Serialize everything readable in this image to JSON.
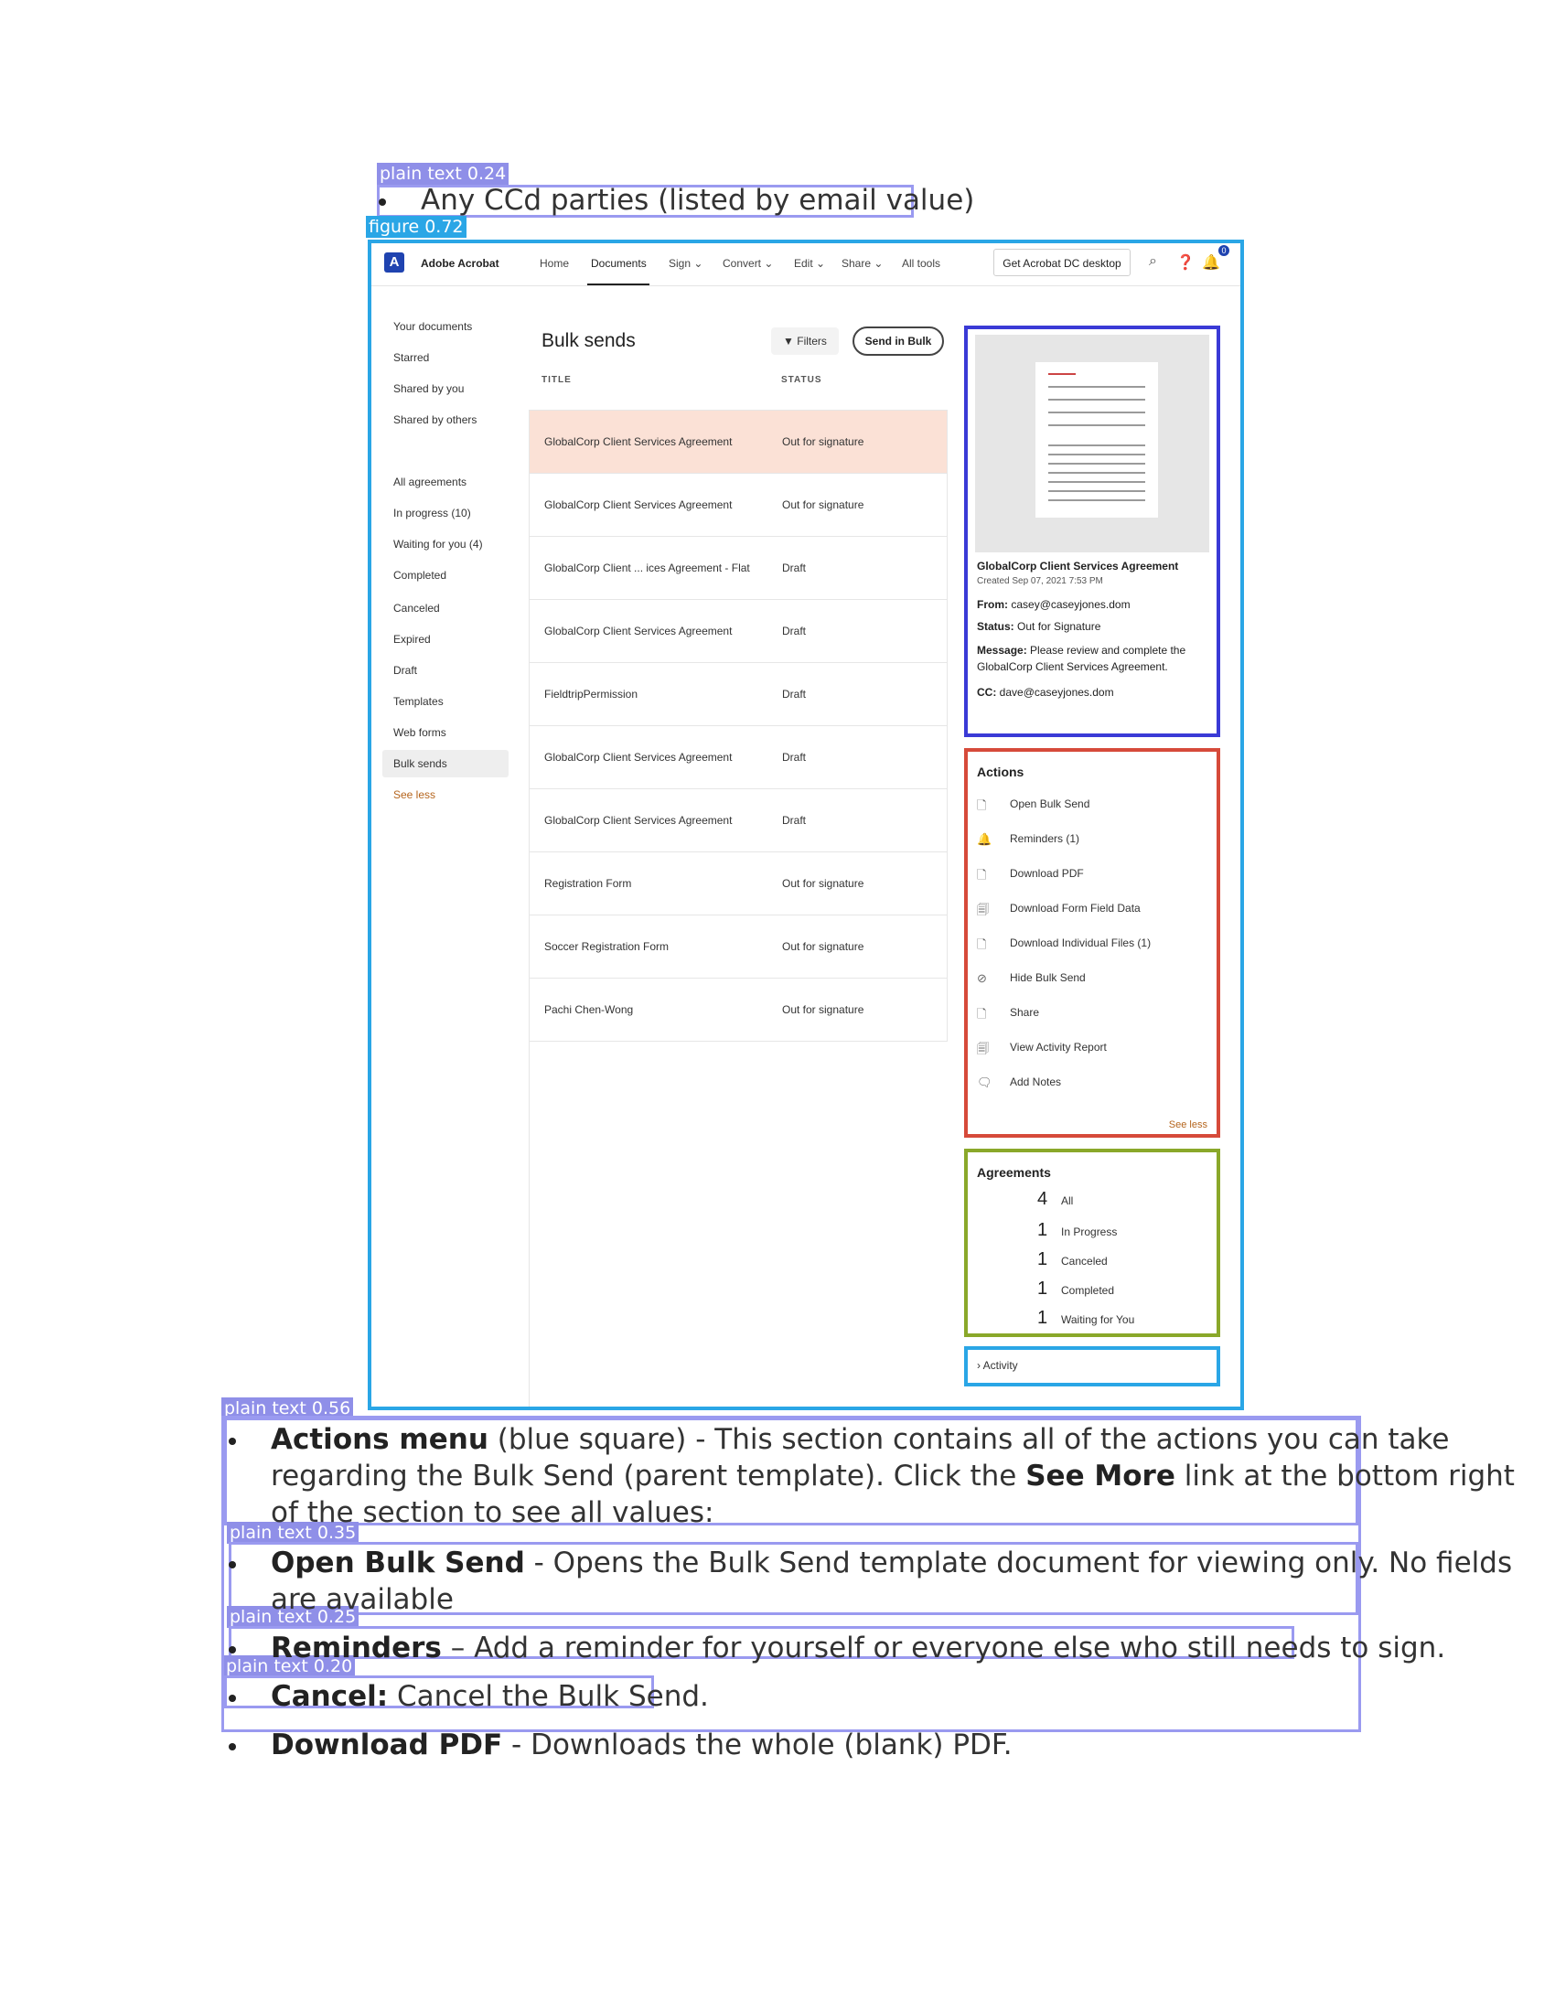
{
  "detections": {
    "d1_label": "plain text 0.24",
    "figure_label": "figure 0.72",
    "d3_label": "plain text 0.56",
    "d4_label": "plain text 0.35",
    "d5_label": "plain text 0.25",
    "d6_label": "plain text 0.20"
  },
  "bullets": {
    "cc": "Any CCd parties (listed by email value)",
    "actions_menu": {
      "bold": "Actions menu",
      "text_a": " (blue square) - This section contains all of the actions you can take",
      "text_b": "regarding the Bulk Send (parent template). Click the ",
      "see_more": "See More",
      "text_c": " link at the bottom right",
      "text_d": "of the section to see all values:"
    },
    "open_bulk": {
      "bold": "Open Bulk Send",
      "text_a": " - Opens the Bulk Send template document for viewing only. No fields",
      "text_b": "are available"
    },
    "reminders": {
      "bold": "Reminders",
      "text": " – Add a reminder for yourself or everyone else who still needs to sign."
    },
    "cancel": {
      "bold": "Cancel:",
      "text": " Cancel the Bulk Send."
    },
    "download": {
      "bold": "Download PDF",
      "text": " - Downloads the whole (blank) PDF."
    }
  },
  "app": {
    "brand": "Adobe Acrobat",
    "nav": [
      "Home",
      "Documents",
      "Sign ⌄",
      "Convert ⌄",
      "Edit ⌄",
      "Share ⌄",
      "All tools"
    ],
    "get_desktop": "Get Acrobat DC desktop",
    "notif_count": "0",
    "sidebar": {
      "group1": [
        "Your documents",
        "Starred",
        "Shared by you",
        "Shared by others"
      ],
      "group2": [
        "All agreements",
        "In progress (10)",
        "Waiting for you (4)",
        "Completed",
        "Canceled",
        "Expired",
        "Draft",
        "Templates",
        "Web forms",
        "Bulk sends"
      ],
      "see_less": "See less"
    },
    "main": {
      "title": "Bulk sends",
      "filters": "Filters",
      "send_in_bulk": "Send in Bulk",
      "col_title": "TITLE",
      "col_status": "STATUS",
      "rows": [
        {
          "title": "GlobalCorp Client Services Agreement",
          "status": "Out for signature"
        },
        {
          "title": "GlobalCorp Client Services Agreement",
          "status": "Out for signature"
        },
        {
          "title": "GlobalCorp Client ... ices Agreement - Flat",
          "status": "Draft"
        },
        {
          "title": "GlobalCorp Client Services Agreement",
          "status": "Draft"
        },
        {
          "title": "FieldtripPermission",
          "status": "Draft"
        },
        {
          "title": "GlobalCorp Client Services Agreement",
          "status": "Draft"
        },
        {
          "title": "GlobalCorp Client Services Agreement",
          "status": "Draft"
        },
        {
          "title": "Registration Form",
          "status": "Out for signature"
        },
        {
          "title": "Soccer Registration Form",
          "status": "Out for signature"
        },
        {
          "title": "Pachi Chen-Wong",
          "status": "Out for signature"
        }
      ]
    },
    "details": {
      "doc_title": "GlobalCorp Client Services Agreement",
      "created": "Created Sep 07, 2021 7:53 PM",
      "from_label": "From:",
      "from": "casey@caseyjones.dom",
      "status_label": "Status:",
      "status": "Out for Signature",
      "message_label": "Message:",
      "message_a": "Please review and complete the",
      "message_b": "GlobalCorp Client Services Agreement.",
      "cc_label": "CC:",
      "cc": "dave@caseyjones.dom"
    },
    "actions": {
      "title": "Actions",
      "items": [
        {
          "label": "Open Bulk Send",
          "icon": "document-icon"
        },
        {
          "label": "Reminders (1)",
          "icon": "bell-icon"
        },
        {
          "label": "Download PDF",
          "icon": "download-pdf-icon"
        },
        {
          "label": "Download Form Field Data",
          "icon": "download-form-icon"
        },
        {
          "label": "Download Individual Files (1)",
          "icon": "download-files-icon"
        },
        {
          "label": "Hide Bulk Send",
          "icon": "hide-icon"
        },
        {
          "label": "Share",
          "icon": "share-icon"
        },
        {
          "label": "View Activity Report",
          "icon": "report-icon"
        },
        {
          "label": "Add Notes",
          "icon": "notes-icon"
        }
      ],
      "see_less": "See less"
    },
    "agreements": {
      "title": "Agreements",
      "items": [
        {
          "count": "4",
          "label": "All"
        },
        {
          "count": "1",
          "label": "In Progress"
        },
        {
          "count": "1",
          "label": "Canceled"
        },
        {
          "count": "1",
          "label": "Completed"
        },
        {
          "count": "1",
          "label": "Waiting for You"
        }
      ]
    },
    "activity": "Activity"
  }
}
